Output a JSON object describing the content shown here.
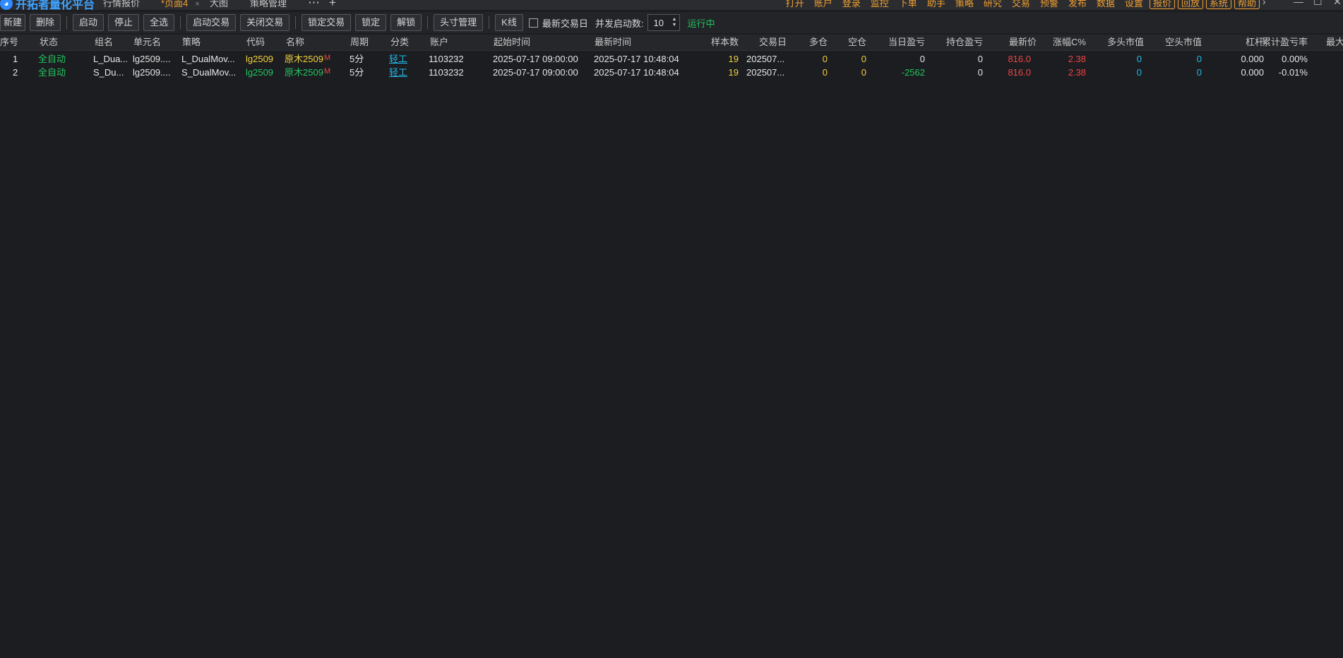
{
  "app": {
    "title": "开拓者量化平台",
    "logo": "logo-icon"
  },
  "tabs": [
    {
      "label": "行情报价"
    },
    {
      "label": "*页面4",
      "active": true,
      "close": "×"
    },
    {
      "label": "大图"
    },
    {
      "label": "策略管理"
    }
  ],
  "tab_actions": {
    "more": "⋯",
    "add": "+"
  },
  "menu": [
    "打开",
    "账户",
    "登录",
    "监控",
    "下单",
    "助手",
    "策略",
    "研究",
    "交易",
    "预警",
    "发布",
    "数据",
    "设置",
    "报价",
    "回放",
    "系统",
    "帮助"
  ],
  "menu_boxed": [
    "报价",
    "回放",
    "系统",
    "帮助"
  ],
  "window": {
    "more": "›",
    "minimize": "—",
    "maximize": "☐",
    "close": "✕"
  },
  "toolbar": {
    "new": "新建",
    "delete": "删除",
    "start": "启动",
    "stop": "停止",
    "select_all": "全选",
    "start_trade": "启动交易",
    "close_trade": "关闭交易",
    "lock_trade": "锁定交易",
    "lock": "锁定",
    "unlock": "解锁",
    "position_mgmt": "头寸管理",
    "kline": "K线",
    "latest_day_label": "最新交易日",
    "latest_day_checked": false,
    "concurrent_label": "并发启动数:",
    "concurrent_value": "10",
    "status": "运行中"
  },
  "columns": [
    "序号",
    "状态",
    "组名",
    "单元名",
    "策略",
    "代码",
    "名称",
    "周期",
    "分类",
    "账户",
    "起始时间",
    "最新时间",
    "样本数",
    "交易日",
    "多仓",
    "空仓",
    "当日盈亏",
    "持仓盈亏",
    "最新价",
    "涨幅C%",
    "多头市值",
    "空头市值",
    "杠杆",
    "累计盈亏率",
    "最大"
  ],
  "rows": [
    {
      "idx": "1",
      "status": "全自动",
      "group": "L_Dua...",
      "unit": "lg2509....",
      "strategy": "L_DualMov...",
      "code": "lg2509",
      "name": "原木2509",
      "name_flag": "M",
      "period": "5分",
      "category": "轻工",
      "account": "1103232",
      "start": "2025-07-17 09:00:00",
      "latest": "2025-07-17 10:48:04",
      "samples": "19",
      "trade_day": "202507...",
      "long": "0",
      "short": "0",
      "day_pnl": "0",
      "pos_pnl": "0",
      "last_price": "816.0",
      "chg": "2.38",
      "long_mv": "0",
      "short_mv": "0",
      "leverage": "0.000",
      "cum_rate": "0.00%"
    },
    {
      "idx": "2",
      "status": "全自动",
      "group": "S_Du...",
      "unit": "lg2509....",
      "strategy": "S_DualMov...",
      "code": "lg2509",
      "name": "原木2509",
      "name_flag": "M",
      "period": "5分",
      "category": "轻工",
      "account": "1103232",
      "start": "2025-07-17 09:00:00",
      "latest": "2025-07-17 10:48:04",
      "samples": "19",
      "trade_day": "202507...",
      "long": "0",
      "short": "0",
      "day_pnl": "-2562",
      "pos_pnl": "0",
      "last_price": "816.0",
      "chg": "2.38",
      "long_mv": "0",
      "short_mv": "0",
      "leverage": "0.000",
      "cum_rate": "-0.01%"
    }
  ],
  "colors": {
    "accent": "#f0a030",
    "positive": "#ef4444",
    "negative": "#22c55e",
    "auto": "#22c55e",
    "cyan": "#22b8e6",
    "yellow": "#f2d13a"
  }
}
